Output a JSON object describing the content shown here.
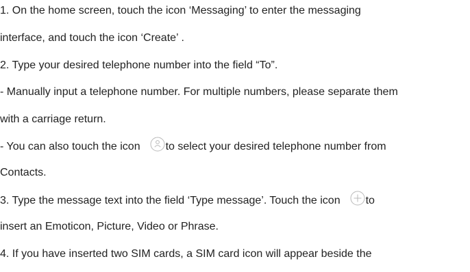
{
  "document": {
    "step1": {
      "line1": "1. On the home screen, touch the icon ‘Messaging’ to enter the messaging",
      "line2": "interface, and touch the icon ‘Create’ ."
    },
    "step2": {
      "line1": "2. Type your desired telephone number into the field “To”.",
      "bullet1_line1": "- Manually input a telephone number. For multiple numbers, please separate them",
      "bullet1_line2": "with a carriage return.",
      "bullet2_before_icon": "- You can also touch the icon",
      "bullet2_after_icon": "to select your desired telephone number from",
      "bullet2_line2": "Contacts."
    },
    "step3": {
      "line1_before_icon": "3. Type the message text into the field ‘Type message’. Touch the icon",
      "line1_after_icon": "to",
      "line2": "insert an Emoticon, Picture, Video or Phrase."
    },
    "step4": {
      "line1": "4. If you have inserted two SIM cards, a SIM card icon will appear beside the"
    }
  },
  "icons": {
    "contacts": "contact-person-icon",
    "insert": "plus-circle-icon",
    "icon_color": "#b9b9b9"
  }
}
